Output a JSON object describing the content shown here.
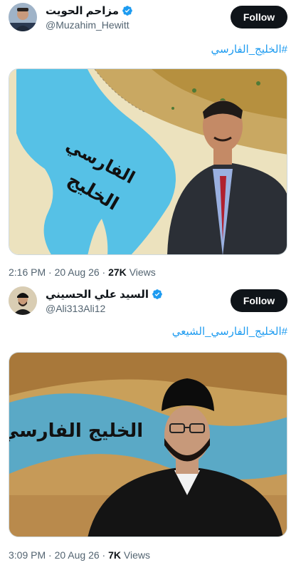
{
  "tweets": [
    {
      "author": {
        "display_name": "مزاحم الحويت",
        "handle": "@Muzahim_Hewitt",
        "verified": true
      },
      "follow_label": "Follow",
      "hashtag": "#الخليج_الفارسي",
      "media": {
        "overlay_line1": "الخليج",
        "overlay_line2": "الفارسي"
      },
      "time": "2:16 PM",
      "date": "20 Aug 26",
      "views_count": "27K",
      "views_label": "Views"
    },
    {
      "author": {
        "display_name": "السيد علي الحسيني",
        "handle": "@Ali313Ali12",
        "verified": true
      },
      "follow_label": "Follow",
      "hashtag": "#الخليج_الفارسي_الشيعي",
      "media": {
        "overlay_text": "الخليج الفارسي"
      },
      "time": "3:09 PM",
      "date": "20 Aug 26",
      "views_count": "7K",
      "views_label": "Views"
    }
  ],
  "separator": "·",
  "colors": {
    "link": "#1d9bf0",
    "secondary_text": "#536471",
    "follow_bg": "#0f1419",
    "gulf_water": "#56c1e6",
    "land": "#e8dcb0",
    "desert": "#b58b3a"
  }
}
